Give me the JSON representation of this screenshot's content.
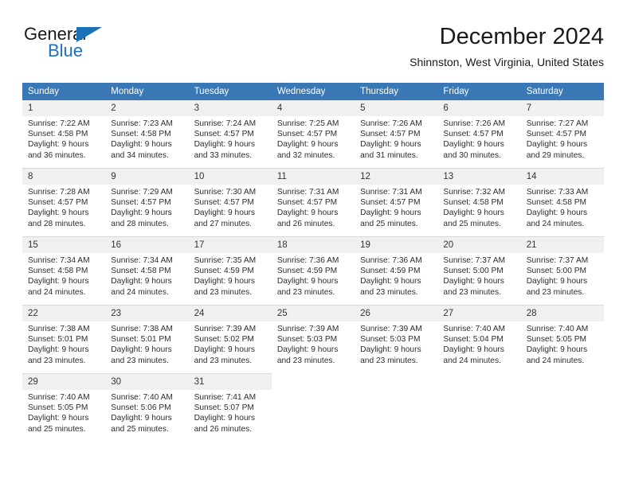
{
  "logo": {
    "word_one": "General",
    "word_two": "Blue",
    "triangle_color": "#1c71b8",
    "text_color": "#1a1a1a"
  },
  "header": {
    "title": "December 2024",
    "subtitle": "Shinnston, West Virginia, United States"
  },
  "theme": {
    "header_blue": "#3a77b5",
    "daynum_band": "#f0f0f0",
    "divider": "#d9d9d9",
    "body_text": "#2d2d2d"
  },
  "calendar": {
    "weekday_headers": [
      "Sunday",
      "Monday",
      "Tuesday",
      "Wednesday",
      "Thursday",
      "Friday",
      "Saturday"
    ],
    "weeks": [
      [
        {
          "day": "1",
          "sunrise": "Sunrise: 7:22 AM",
          "sunset": "Sunset: 4:58 PM",
          "daylight_1": "Daylight: 9 hours",
          "daylight_2": "and 36 minutes."
        },
        {
          "day": "2",
          "sunrise": "Sunrise: 7:23 AM",
          "sunset": "Sunset: 4:58 PM",
          "daylight_1": "Daylight: 9 hours",
          "daylight_2": "and 34 minutes."
        },
        {
          "day": "3",
          "sunrise": "Sunrise: 7:24 AM",
          "sunset": "Sunset: 4:57 PM",
          "daylight_1": "Daylight: 9 hours",
          "daylight_2": "and 33 minutes."
        },
        {
          "day": "4",
          "sunrise": "Sunrise: 7:25 AM",
          "sunset": "Sunset: 4:57 PM",
          "daylight_1": "Daylight: 9 hours",
          "daylight_2": "and 32 minutes."
        },
        {
          "day": "5",
          "sunrise": "Sunrise: 7:26 AM",
          "sunset": "Sunset: 4:57 PM",
          "daylight_1": "Daylight: 9 hours",
          "daylight_2": "and 31 minutes."
        },
        {
          "day": "6",
          "sunrise": "Sunrise: 7:26 AM",
          "sunset": "Sunset: 4:57 PM",
          "daylight_1": "Daylight: 9 hours",
          "daylight_2": "and 30 minutes."
        },
        {
          "day": "7",
          "sunrise": "Sunrise: 7:27 AM",
          "sunset": "Sunset: 4:57 PM",
          "daylight_1": "Daylight: 9 hours",
          "daylight_2": "and 29 minutes."
        }
      ],
      [
        {
          "day": "8",
          "sunrise": "Sunrise: 7:28 AM",
          "sunset": "Sunset: 4:57 PM",
          "daylight_1": "Daylight: 9 hours",
          "daylight_2": "and 28 minutes."
        },
        {
          "day": "9",
          "sunrise": "Sunrise: 7:29 AM",
          "sunset": "Sunset: 4:57 PM",
          "daylight_1": "Daylight: 9 hours",
          "daylight_2": "and 28 minutes."
        },
        {
          "day": "10",
          "sunrise": "Sunrise: 7:30 AM",
          "sunset": "Sunset: 4:57 PM",
          "daylight_1": "Daylight: 9 hours",
          "daylight_2": "and 27 minutes."
        },
        {
          "day": "11",
          "sunrise": "Sunrise: 7:31 AM",
          "sunset": "Sunset: 4:57 PM",
          "daylight_1": "Daylight: 9 hours",
          "daylight_2": "and 26 minutes."
        },
        {
          "day": "12",
          "sunrise": "Sunrise: 7:31 AM",
          "sunset": "Sunset: 4:57 PM",
          "daylight_1": "Daylight: 9 hours",
          "daylight_2": "and 25 minutes."
        },
        {
          "day": "13",
          "sunrise": "Sunrise: 7:32 AM",
          "sunset": "Sunset: 4:58 PM",
          "daylight_1": "Daylight: 9 hours",
          "daylight_2": "and 25 minutes."
        },
        {
          "day": "14",
          "sunrise": "Sunrise: 7:33 AM",
          "sunset": "Sunset: 4:58 PM",
          "daylight_1": "Daylight: 9 hours",
          "daylight_2": "and 24 minutes."
        }
      ],
      [
        {
          "day": "15",
          "sunrise": "Sunrise: 7:34 AM",
          "sunset": "Sunset: 4:58 PM",
          "daylight_1": "Daylight: 9 hours",
          "daylight_2": "and 24 minutes."
        },
        {
          "day": "16",
          "sunrise": "Sunrise: 7:34 AM",
          "sunset": "Sunset: 4:58 PM",
          "daylight_1": "Daylight: 9 hours",
          "daylight_2": "and 24 minutes."
        },
        {
          "day": "17",
          "sunrise": "Sunrise: 7:35 AM",
          "sunset": "Sunset: 4:59 PM",
          "daylight_1": "Daylight: 9 hours",
          "daylight_2": "and 23 minutes."
        },
        {
          "day": "18",
          "sunrise": "Sunrise: 7:36 AM",
          "sunset": "Sunset: 4:59 PM",
          "daylight_1": "Daylight: 9 hours",
          "daylight_2": "and 23 minutes."
        },
        {
          "day": "19",
          "sunrise": "Sunrise: 7:36 AM",
          "sunset": "Sunset: 4:59 PM",
          "daylight_1": "Daylight: 9 hours",
          "daylight_2": "and 23 minutes."
        },
        {
          "day": "20",
          "sunrise": "Sunrise: 7:37 AM",
          "sunset": "Sunset: 5:00 PM",
          "daylight_1": "Daylight: 9 hours",
          "daylight_2": "and 23 minutes."
        },
        {
          "day": "21",
          "sunrise": "Sunrise: 7:37 AM",
          "sunset": "Sunset: 5:00 PM",
          "daylight_1": "Daylight: 9 hours",
          "daylight_2": "and 23 minutes."
        }
      ],
      [
        {
          "day": "22",
          "sunrise": "Sunrise: 7:38 AM",
          "sunset": "Sunset: 5:01 PM",
          "daylight_1": "Daylight: 9 hours",
          "daylight_2": "and 23 minutes."
        },
        {
          "day": "23",
          "sunrise": "Sunrise: 7:38 AM",
          "sunset": "Sunset: 5:01 PM",
          "daylight_1": "Daylight: 9 hours",
          "daylight_2": "and 23 minutes."
        },
        {
          "day": "24",
          "sunrise": "Sunrise: 7:39 AM",
          "sunset": "Sunset: 5:02 PM",
          "daylight_1": "Daylight: 9 hours",
          "daylight_2": "and 23 minutes."
        },
        {
          "day": "25",
          "sunrise": "Sunrise: 7:39 AM",
          "sunset": "Sunset: 5:03 PM",
          "daylight_1": "Daylight: 9 hours",
          "daylight_2": "and 23 minutes."
        },
        {
          "day": "26",
          "sunrise": "Sunrise: 7:39 AM",
          "sunset": "Sunset: 5:03 PM",
          "daylight_1": "Daylight: 9 hours",
          "daylight_2": "and 23 minutes."
        },
        {
          "day": "27",
          "sunrise": "Sunrise: 7:40 AM",
          "sunset": "Sunset: 5:04 PM",
          "daylight_1": "Daylight: 9 hours",
          "daylight_2": "and 24 minutes."
        },
        {
          "day": "28",
          "sunrise": "Sunrise: 7:40 AM",
          "sunset": "Sunset: 5:05 PM",
          "daylight_1": "Daylight: 9 hours",
          "daylight_2": "and 24 minutes."
        }
      ],
      [
        {
          "day": "29",
          "sunrise": "Sunrise: 7:40 AM",
          "sunset": "Sunset: 5:05 PM",
          "daylight_1": "Daylight: 9 hours",
          "daylight_2": "and 25 minutes."
        },
        {
          "day": "30",
          "sunrise": "Sunrise: 7:40 AM",
          "sunset": "Sunset: 5:06 PM",
          "daylight_1": "Daylight: 9 hours",
          "daylight_2": "and 25 minutes."
        },
        {
          "day": "31",
          "sunrise": "Sunrise: 7:41 AM",
          "sunset": "Sunset: 5:07 PM",
          "daylight_1": "Daylight: 9 hours",
          "daylight_2": "and 26 minutes."
        },
        {
          "day": "",
          "sunrise": "",
          "sunset": "",
          "daylight_1": "",
          "daylight_2": ""
        },
        {
          "day": "",
          "sunrise": "",
          "sunset": "",
          "daylight_1": "",
          "daylight_2": ""
        },
        {
          "day": "",
          "sunrise": "",
          "sunset": "",
          "daylight_1": "",
          "daylight_2": ""
        },
        {
          "day": "",
          "sunrise": "",
          "sunset": "",
          "daylight_1": "",
          "daylight_2": ""
        }
      ]
    ]
  }
}
